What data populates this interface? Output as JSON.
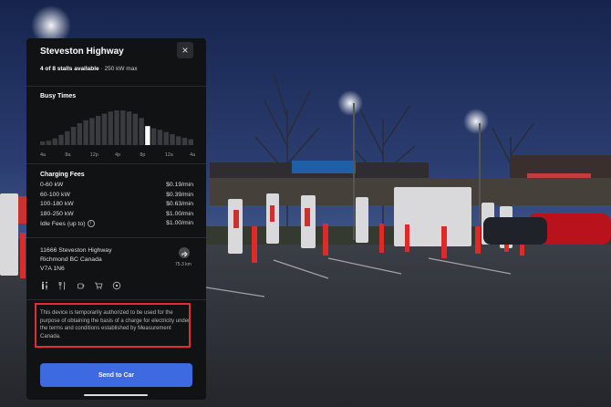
{
  "station": {
    "name": "Steveston Highway",
    "stalls_available": "4 of 8 stalls available",
    "max_power": " · 250 kW max"
  },
  "busy_times": {
    "title": "Busy Times",
    "ticks": [
      "4a",
      "8a",
      "12p",
      "4p",
      "8p",
      "12a",
      "4a"
    ],
    "bars": [
      0.1,
      0.12,
      0.18,
      0.28,
      0.38,
      0.5,
      0.6,
      0.68,
      0.74,
      0.8,
      0.86,
      0.92,
      0.95,
      0.95,
      0.92,
      0.86,
      0.74,
      0.52,
      0.46,
      0.42,
      0.36,
      0.3,
      0.24,
      0.2,
      0.16
    ],
    "highlight_index": 17
  },
  "charging_fees": {
    "title": "Charging Fees",
    "rows": [
      {
        "label": "0-60 kW",
        "price": "$0.19/min"
      },
      {
        "label": "60-100 kW",
        "price": "$0.39/min"
      },
      {
        "label": "100-180 kW",
        "price": "$0.63/min"
      },
      {
        "label": "180-250 kW",
        "price": "$1.00/min"
      },
      {
        "label": "Idle Fees (up to)",
        "price": "$1.00/min"
      }
    ]
  },
  "address": {
    "line1": "11666 Steveston Highway",
    "line2": "Richmond BC Canada",
    "line3": "V7A 1N6",
    "distance": "75.3 km"
  },
  "amenities": [
    "restroom-icon",
    "restaurant-icon",
    "coffee-icon",
    "shopping-cart-icon",
    "wifi-icon"
  ],
  "disclaimer": "This device is temporarily authorized to be used for the purpose of obtaining the basis of a charge for electricity under the terms and conditions established by Measurement Canada.",
  "send_button": "Send to Car",
  "colors": {
    "accent": "#3e6ae1",
    "annotation": "#e03030",
    "panel_bg": "#111214"
  }
}
